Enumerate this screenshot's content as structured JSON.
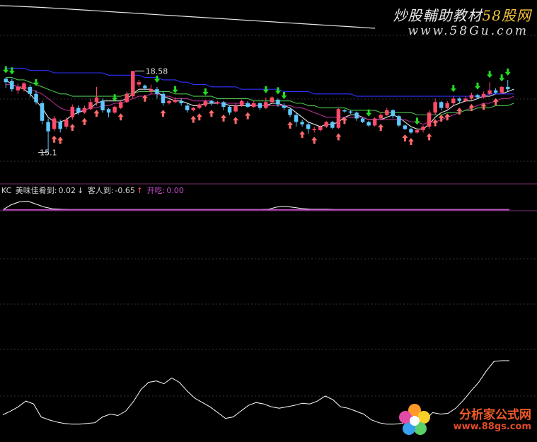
{
  "watermark": {
    "top_title_main": "炒股輔助教材",
    "top_title_accent": "58股网",
    "top_url": "www.58Gu.com",
    "bottom_title": "分析家公式网",
    "bottom_url": "www.88gs.com"
  },
  "colors": {
    "background": "#000000",
    "up_candle": "#ff4a6a",
    "down_candle": "#5fc8ff",
    "buy_arrow": "#ff6a6a",
    "sell_arrow": "#22dd22",
    "ma_blue": "#3030ff",
    "ma_green": "#4cc04c",
    "ma_magenta": "#b03090",
    "ma_white": "#e8e8e8",
    "indicator_magenta": "#c94fd0",
    "grid_dotted": "#333333",
    "divider": "#7a2f6e"
  },
  "indicator_bar": {
    "name": "KC",
    "line1_label": "美味佳肴到:",
    "line1_value": "0.02",
    "line1_arrow": "↓",
    "line2_label": "客人到:",
    "line2_value": "-0.65",
    "line2_arrow": "↑",
    "line3_label": "开吃:",
    "line3_value": "0.00"
  },
  "chart_data": [
    {
      "type": "candlestick",
      "annotations": [
        "18.58",
        "15.1"
      ],
      "high_label": "18.58",
      "low_label": "15.1",
      "ylim": [
        14.6,
        19.8
      ],
      "candles": [
        [
          18.1,
          18.25,
          17.85,
          18.3,
          "d"
        ],
        [
          18.15,
          17.8,
          17.7,
          18.25,
          "d"
        ],
        [
          17.9,
          17.75,
          17.6,
          18.05,
          "u"
        ],
        [
          17.8,
          18.05,
          17.7,
          18.1,
          "u"
        ],
        [
          17.9,
          17.6,
          17.45,
          18.0,
          "d"
        ],
        [
          17.6,
          17.25,
          17.15,
          17.75,
          "d"
        ],
        [
          17.2,
          16.45,
          16.3,
          17.3,
          "d"
        ],
        [
          16.4,
          16.0,
          15.1,
          16.55,
          "d"
        ],
        [
          16.1,
          16.55,
          16.0,
          16.65,
          "u"
        ],
        [
          16.4,
          16.1,
          15.95,
          16.5,
          "d"
        ],
        [
          16.2,
          16.5,
          16.1,
          16.6,
          "u"
        ],
        [
          16.6,
          17.05,
          16.5,
          17.15,
          "u"
        ],
        [
          17.0,
          16.8,
          16.7,
          17.1,
          "d"
        ],
        [
          16.8,
          17.0,
          16.75,
          17.1,
          "u"
        ],
        [
          16.95,
          17.25,
          16.9,
          17.4,
          "u"
        ],
        [
          17.25,
          17.45,
          17.1,
          17.9,
          "u"
        ],
        [
          17.3,
          16.9,
          16.8,
          17.4,
          "d"
        ],
        [
          16.95,
          16.8,
          16.6,
          17.0,
          "d"
        ],
        [
          16.8,
          17.05,
          16.75,
          17.1,
          "u"
        ],
        [
          17.0,
          17.25,
          16.95,
          17.3,
          "u"
        ],
        [
          17.25,
          17.6,
          17.2,
          17.7,
          "u"
        ],
        [
          17.5,
          18.58,
          17.4,
          18.58,
          "u"
        ],
        [
          18.0,
          18.1,
          17.9,
          18.2,
          "u"
        ],
        [
          17.95,
          17.85,
          17.75,
          18.0,
          "d"
        ],
        [
          17.7,
          17.8,
          17.6,
          18.0,
          "u"
        ],
        [
          17.8,
          17.6,
          17.4,
          17.9,
          "d"
        ],
        [
          17.6,
          17.2,
          17.1,
          17.7,
          "d"
        ],
        [
          17.2,
          17.3,
          17.15,
          17.35,
          "u"
        ],
        [
          17.25,
          17.35,
          17.2,
          17.45,
          "u"
        ],
        [
          17.3,
          17.2,
          17.1,
          17.4,
          "d"
        ],
        [
          17.1,
          16.9,
          16.8,
          17.2,
          "d"
        ],
        [
          16.9,
          17.0,
          16.85,
          17.05,
          "u"
        ],
        [
          17.0,
          17.15,
          16.95,
          17.2,
          "u"
        ],
        [
          17.1,
          17.3,
          17.05,
          17.35,
          "u"
        ],
        [
          17.3,
          17.2,
          17.1,
          17.35,
          "d"
        ],
        [
          17.2,
          17.25,
          17.15,
          17.3,
          "u"
        ],
        [
          17.25,
          17.05,
          16.9,
          17.3,
          "d"
        ],
        [
          17.05,
          16.8,
          16.7,
          17.1,
          "d"
        ],
        [
          16.85,
          17.1,
          16.8,
          17.2,
          "u"
        ],
        [
          17.1,
          17.3,
          17.05,
          17.35,
          "u"
        ],
        [
          17.2,
          17.05,
          17.0,
          17.3,
          "d"
        ],
        [
          17.05,
          17.2,
          17.0,
          17.3,
          "u"
        ],
        [
          17.2,
          17.0,
          16.9,
          17.25,
          "d"
        ],
        [
          17.0,
          17.25,
          16.95,
          17.45,
          "u"
        ],
        [
          17.25,
          17.45,
          17.2,
          17.5,
          "u"
        ],
        [
          17.35,
          17.15,
          17.05,
          17.4,
          "d"
        ],
        [
          17.1,
          17.0,
          16.9,
          17.2,
          "d"
        ],
        [
          16.95,
          16.7,
          16.6,
          17.0,
          "d"
        ],
        [
          16.7,
          16.4,
          16.2,
          16.8,
          "d"
        ],
        [
          16.4,
          16.3,
          16.2,
          16.5,
          "d"
        ],
        [
          16.3,
          16.1,
          15.9,
          16.4,
          "d"
        ],
        [
          16.1,
          16.05,
          15.95,
          16.2,
          "u"
        ],
        [
          16.05,
          16.2,
          16.0,
          16.25,
          "u"
        ],
        [
          16.2,
          16.4,
          16.15,
          16.45,
          "u"
        ],
        [
          16.4,
          16.15,
          16.1,
          16.45,
          "d"
        ],
        [
          16.15,
          16.95,
          16.1,
          17.0,
          "u"
        ],
        [
          16.9,
          16.85,
          16.8,
          16.95,
          "d"
        ],
        [
          16.85,
          16.8,
          16.75,
          16.9,
          "d"
        ],
        [
          16.8,
          16.55,
          16.45,
          16.85,
          "d"
        ],
        [
          16.55,
          16.4,
          16.35,
          16.6,
          "d"
        ],
        [
          16.4,
          16.25,
          16.2,
          16.45,
          "d"
        ],
        [
          16.25,
          16.55,
          16.2,
          16.6,
          "u"
        ],
        [
          16.55,
          16.7,
          16.5,
          16.8,
          "u"
        ],
        [
          16.7,
          16.9,
          16.65,
          17.0,
          "u"
        ],
        [
          16.9,
          16.65,
          16.55,
          16.95,
          "d"
        ],
        [
          16.65,
          16.25,
          16.2,
          16.7,
          "d"
        ],
        [
          16.25,
          16.1,
          16.05,
          16.3,
          "d"
        ],
        [
          16.1,
          15.95,
          15.9,
          16.15,
          "d"
        ],
        [
          15.95,
          16.05,
          15.9,
          16.1,
          "u"
        ],
        [
          16.05,
          16.2,
          15.95,
          16.25,
          "u"
        ],
        [
          16.2,
          16.8,
          16.1,
          16.9,
          "u"
        ],
        [
          16.8,
          17.25,
          16.7,
          17.4,
          "u"
        ],
        [
          17.25,
          17.0,
          16.9,
          17.3,
          "d"
        ],
        [
          17.0,
          17.2,
          16.95,
          17.3,
          "u"
        ],
        [
          17.2,
          17.4,
          17.1,
          17.5,
          "u"
        ],
        [
          17.4,
          17.3,
          17.2,
          17.45,
          "d"
        ],
        [
          17.3,
          17.4,
          17.25,
          17.5,
          "u"
        ],
        [
          17.4,
          17.55,
          17.35,
          17.65,
          "u"
        ],
        [
          17.55,
          17.45,
          17.4,
          17.6,
          "d"
        ],
        [
          17.45,
          17.6,
          17.4,
          17.7,
          "u"
        ],
        [
          17.6,
          17.75,
          17.55,
          18.1,
          "u"
        ],
        [
          17.75,
          17.65,
          17.6,
          17.85,
          "d"
        ],
        [
          17.65,
          17.9,
          17.6,
          17.95,
          "u"
        ],
        [
          17.9,
          17.8,
          17.7,
          18.2,
          "d"
        ]
      ],
      "sell_arrows_at": [
        0,
        1,
        5,
        18,
        25,
        28,
        33,
        43,
        45,
        46,
        60,
        68,
        74,
        78,
        80,
        82,
        83
      ],
      "buy_arrows_at": [
        8,
        9,
        11,
        13,
        15,
        19,
        23,
        26,
        31,
        32,
        34,
        36,
        38,
        40,
        47,
        49,
        51,
        55,
        56,
        62,
        66,
        67,
        70,
        71,
        72,
        73,
        75,
        77,
        79,
        81
      ],
      "ma_series": [
        {
          "color_key": "ma_white",
          "values": [
            18.2,
            18.0,
            17.9,
            17.8,
            17.6,
            17.3,
            17.0,
            16.6,
            16.4,
            16.4,
            16.5,
            16.7,
            16.8,
            16.9,
            17.0,
            17.2,
            17.3,
            17.3,
            17.3,
            17.3,
            17.4,
            17.6,
            17.8,
            17.8,
            17.8,
            17.7,
            17.5,
            17.4,
            17.3,
            17.3,
            17.2,
            17.1,
            17.1,
            17.2,
            17.2,
            17.2,
            17.2,
            17.1,
            17.1,
            17.1,
            17.1,
            17.1,
            17.1,
            17.1,
            17.2,
            17.2,
            17.1,
            17.0,
            16.8,
            16.6,
            16.4,
            16.3,
            16.2,
            16.3,
            16.3,
            16.4,
            16.6,
            16.7,
            16.7,
            16.6,
            16.5,
            16.5,
            16.5,
            16.6,
            16.7,
            16.6,
            16.4,
            16.2,
            16.1,
            16.1,
            16.3,
            16.6,
            16.8,
            16.9,
            17.1,
            17.2,
            17.3,
            17.3,
            17.4,
            17.5,
            17.5,
            17.6,
            17.6,
            17.7,
            17.8
          ]
        },
        {
          "color_key": "ma_magenta",
          "values": [
            18.0,
            18.0,
            17.9,
            17.9,
            17.8,
            17.7,
            17.6,
            17.4,
            17.2,
            17.0,
            16.9,
            16.9,
            16.9,
            16.9,
            17.0,
            17.0,
            17.1,
            17.1,
            17.2,
            17.2,
            17.3,
            17.4,
            17.5,
            17.5,
            17.6,
            17.6,
            17.5,
            17.5,
            17.4,
            17.4,
            17.4,
            17.3,
            17.3,
            17.3,
            17.3,
            17.2,
            17.2,
            17.2,
            17.2,
            17.2,
            17.2,
            17.1,
            17.1,
            17.1,
            17.1,
            17.1,
            17.1,
            17.1,
            17.0,
            17.0,
            16.9,
            16.8,
            16.7,
            16.6,
            16.6,
            16.6,
            16.6,
            16.6,
            16.6,
            16.6,
            16.5,
            16.5,
            16.5,
            16.5,
            16.5,
            16.5,
            16.5,
            16.4,
            16.4,
            16.3,
            16.4,
            16.4,
            16.5,
            16.6,
            16.7,
            16.8,
            16.9,
            17.0,
            17.1,
            17.2,
            17.2,
            17.3,
            17.4,
            17.4,
            17.5
          ]
        },
        {
          "color_key": "ma_green",
          "values": [
            18.3,
            18.3,
            18.2,
            18.2,
            18.1,
            18.0,
            17.9,
            17.8,
            17.7,
            17.6,
            17.6,
            17.5,
            17.5,
            17.5,
            17.5,
            17.5,
            17.5,
            17.5,
            17.5,
            17.5,
            17.6,
            17.6,
            17.7,
            17.7,
            17.7,
            17.7,
            17.7,
            17.7,
            17.6,
            17.6,
            17.6,
            17.5,
            17.5,
            17.5,
            17.5,
            17.4,
            17.4,
            17.4,
            17.4,
            17.4,
            17.4,
            17.3,
            17.3,
            17.3,
            17.3,
            17.3,
            17.3,
            17.3,
            17.2,
            17.2,
            17.1,
            17.1,
            17.0,
            17.0,
            17.0,
            17.0,
            17.0,
            16.9,
            16.9,
            16.9,
            16.9,
            16.9,
            16.8,
            16.8,
            16.8,
            16.8,
            16.8,
            16.8,
            16.7,
            16.7,
            16.7,
            16.7,
            16.7,
            16.8,
            16.8,
            16.8,
            16.9,
            16.9,
            17.0,
            17.0,
            17.0,
            17.1,
            17.1,
            17.1,
            17.2
          ]
        },
        {
          "color_key": "ma_blue",
          "values": [
            18.7,
            18.7,
            18.7,
            18.7,
            18.6,
            18.6,
            18.6,
            18.6,
            18.5,
            18.5,
            18.5,
            18.5,
            18.5,
            18.5,
            18.5,
            18.5,
            18.5,
            18.4,
            18.4,
            18.4,
            18.4,
            18.4,
            18.4,
            18.3,
            18.3,
            18.3,
            18.2,
            18.2,
            18.2,
            18.1,
            18.1,
            18.0,
            18.0,
            18.0,
            17.9,
            17.9,
            17.9,
            17.9,
            17.9,
            17.8,
            17.8,
            17.8,
            17.8,
            17.8,
            17.8,
            17.8,
            17.7,
            17.7,
            17.7,
            17.7,
            17.7,
            17.6,
            17.6,
            17.6,
            17.6,
            17.6,
            17.6,
            17.6,
            17.5,
            17.5,
            17.5,
            17.5,
            17.5,
            17.5,
            17.5,
            17.5,
            17.5,
            17.5,
            17.5,
            17.5,
            17.5,
            17.5,
            17.5,
            17.5,
            17.5,
            17.5,
            17.5,
            17.5,
            17.5,
            17.5,
            17.6,
            17.6,
            17.6,
            17.6,
            17.6
          ]
        }
      ],
      "top_line": [
        0.0,
        0.02,
        0.05,
        0.08,
        0.12,
        0.16,
        0.2,
        0.24,
        0.28,
        0.32,
        0.36,
        0.4,
        0.44,
        0.48,
        0.52,
        0.56,
        0.6,
        0.64,
        0.68,
        0.72,
        0.76,
        0.8,
        0.84,
        0.88,
        0.92,
        0.96,
        1.0
      ]
    },
    {
      "type": "line",
      "name": "KC",
      "ylim": [
        0,
        1
      ],
      "magenta_line": 0.02,
      "white_values": [
        0.02,
        0.35,
        0.55,
        0.6,
        0.4,
        0.2,
        0.08,
        0.05,
        0.04,
        0.04,
        0.04,
        0.04,
        0.04,
        0.04,
        0.04,
        0.04,
        0.04,
        0.04,
        0.04,
        0.04,
        0.04,
        0.04,
        0.04,
        0.04,
        0.04,
        0.04,
        0.04,
        0.04,
        0.04,
        0.04,
        0.04,
        0.04,
        0.05,
        0.2,
        0.25,
        0.18,
        0.1,
        0.06,
        0.05,
        0.05,
        0.04,
        0.04,
        0.04,
        0.04,
        0.04,
        0.04,
        0.04,
        0.04,
        0.04,
        0.04,
        0.04,
        0.04,
        0.04,
        0.04,
        0.04,
        0.04,
        0.04,
        0.04,
        0.04,
        0.04,
        0.04,
        0.04
      ]
    },
    {
      "type": "line",
      "ylim": [
        0,
        100
      ],
      "values": [
        25,
        30,
        36,
        44,
        40,
        22,
        18,
        15,
        13,
        12,
        12,
        13,
        14,
        22,
        26,
        24,
        30,
        43,
        60,
        70,
        72,
        68,
        76,
        70,
        58,
        48,
        42,
        36,
        28,
        20,
        22,
        30,
        38,
        42,
        40,
        36,
        34,
        36,
        38,
        41,
        40,
        44,
        51,
        46,
        36,
        34,
        30,
        26,
        18,
        14,
        12,
        12,
        13,
        17,
        15,
        17,
        28,
        26,
        27,
        34,
        45,
        58,
        70,
        86,
        99,
        100,
        100
      ]
    }
  ]
}
